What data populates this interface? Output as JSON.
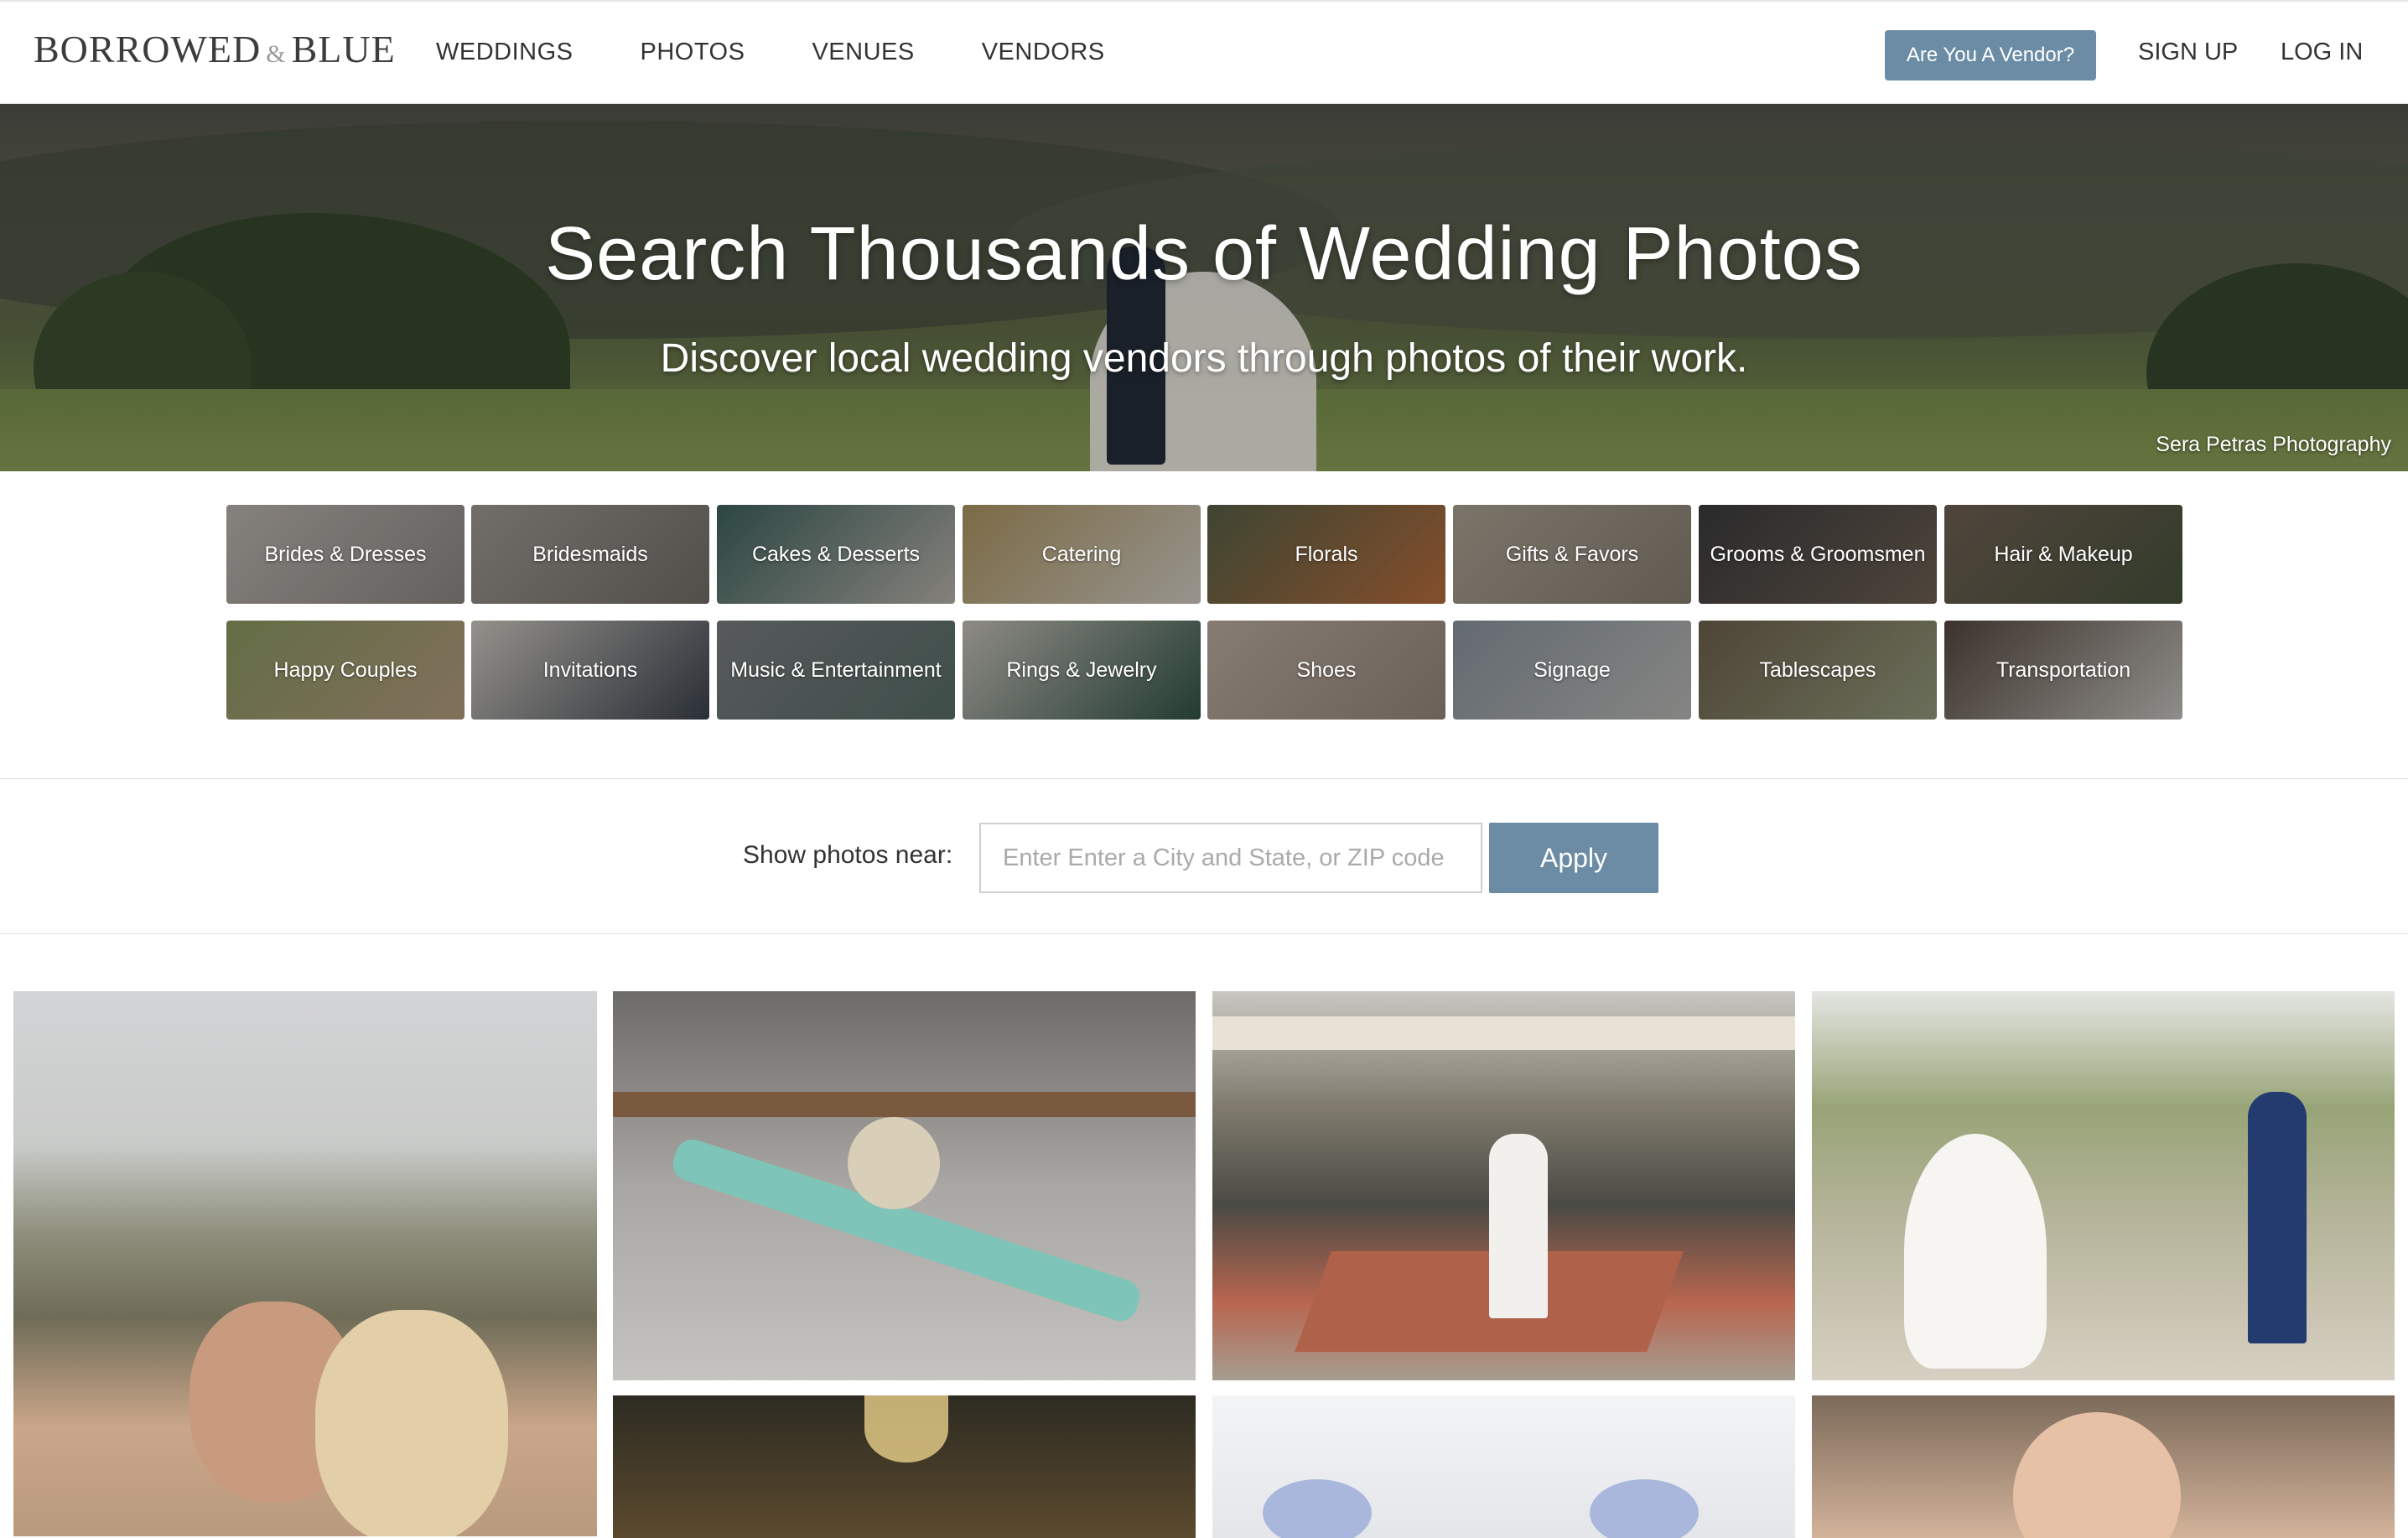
{
  "header": {
    "logo_word1": "BORROWED",
    "logo_amp": "&",
    "logo_word2": "BLUE",
    "nav": [
      "WEDDINGS",
      "PHOTOS",
      "VENUES",
      "VENDORS"
    ],
    "vendor_button": "Are You A Vendor?",
    "signup": "SIGN UP",
    "login": "LOG IN"
  },
  "hero": {
    "title": "Search Thousands of Wedding Photos",
    "subtitle": "Discover local wedding vendors through photos of their work.",
    "credit": "Sera Petras Photography"
  },
  "categories": [
    "Brides & Dresses",
    "Bridesmaids",
    "Cakes & Desserts",
    "Catering",
    "Florals",
    "Gifts & Favors",
    "Grooms & Groomsmen",
    "Hair & Makeup",
    "Happy Couples",
    "Invitations",
    "Music & Entertainment",
    "Rings & Jewelry",
    "Shoes",
    "Signage",
    "Tablescapes",
    "Transportation"
  ],
  "filter": {
    "label": "Show photos near:",
    "placeholder": "Enter Enter a City and State, or ZIP code",
    "button": "Apply"
  },
  "colors": {
    "accent": "#6b8ca4",
    "text": "#333333"
  }
}
